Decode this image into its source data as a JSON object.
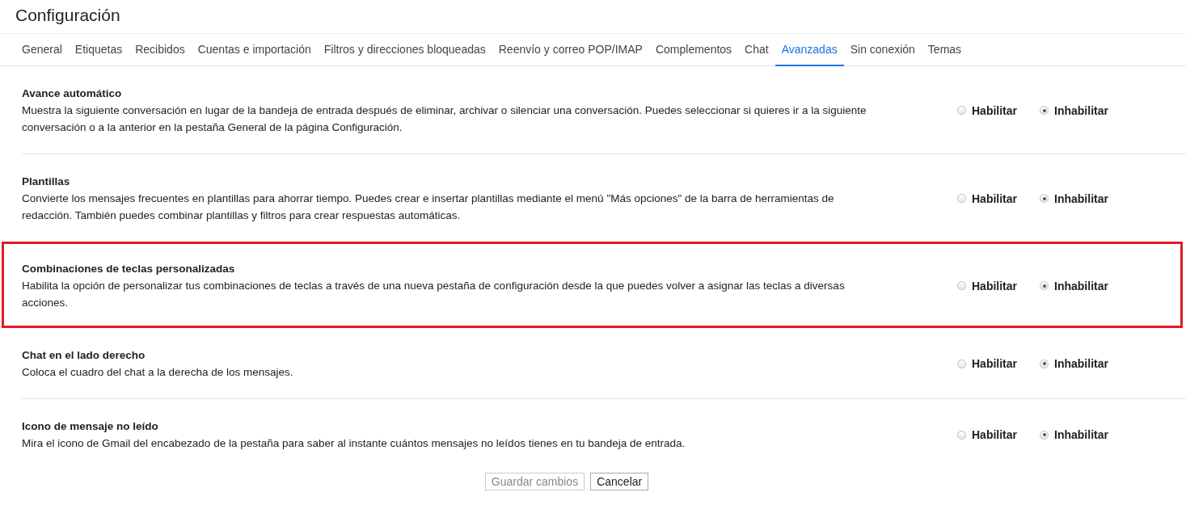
{
  "page": {
    "title": "Configuración"
  },
  "tabs": [
    {
      "label": "General",
      "selected": false
    },
    {
      "label": "Etiquetas",
      "selected": false
    },
    {
      "label": "Recibidos",
      "selected": false
    },
    {
      "label": "Cuentas e importación",
      "selected": false
    },
    {
      "label": "Filtros y direcciones bloqueadas",
      "selected": false
    },
    {
      "label": "Reenvío y correo POP/IMAP",
      "selected": false
    },
    {
      "label": "Complementos",
      "selected": false
    },
    {
      "label": "Chat",
      "selected": false
    },
    {
      "label": "Avanzadas",
      "selected": true
    },
    {
      "label": "Sin conexión",
      "selected": false
    },
    {
      "label": "Temas",
      "selected": false
    }
  ],
  "settings": [
    {
      "title": "Avance automático",
      "description": "Muestra la siguiente conversación en lugar de la bandeja de entrada después de eliminar, archivar o silenciar una conversación. Puedes seleccionar si quieres ir a la siguiente conversación o a la anterior en la pestaña General de la página Configuración.",
      "highlighted": false,
      "options": [
        {
          "label": "Habilitar",
          "selected": false
        },
        {
          "label": "Inhabilitar",
          "selected": true
        }
      ]
    },
    {
      "title": "Plantillas",
      "description": "Convierte los mensajes frecuentes en plantillas para ahorrar tiempo. Puedes crear e insertar plantillas mediante el menú \"Más opciones\" de la barra de herramientas de redacción. También puedes combinar plantillas y filtros para crear respuestas automáticas.",
      "highlighted": false,
      "options": [
        {
          "label": "Habilitar",
          "selected": false
        },
        {
          "label": "Inhabilitar",
          "selected": true
        }
      ]
    },
    {
      "title": "Combinaciones de teclas personalizadas",
      "description": "Habilita la opción de personalizar tus combinaciones de teclas a través de una nueva pestaña de configuración desde la que puedes volver a asignar las teclas a diversas acciones.",
      "highlighted": true,
      "options": [
        {
          "label": "Habilitar",
          "selected": false
        },
        {
          "label": "Inhabilitar",
          "selected": true
        }
      ]
    },
    {
      "title": "Chat en el lado derecho",
      "description": "Coloca el cuadro del chat a la derecha de los mensajes.",
      "highlighted": false,
      "options": [
        {
          "label": "Habilitar",
          "selected": false
        },
        {
          "label": "Inhabilitar",
          "selected": true
        }
      ]
    },
    {
      "title": "Icono de mensaje no leído",
      "description": "Mira el icono de Gmail del encabezado de la pestaña para saber al instante cuántos mensajes no leídos tienes en tu bandeja de entrada.",
      "highlighted": false,
      "options": [
        {
          "label": "Habilitar",
          "selected": false
        },
        {
          "label": "Inhabilitar",
          "selected": true
        }
      ]
    }
  ],
  "buttons": [
    {
      "label": "Guardar cambios",
      "disabled": true
    },
    {
      "label": "Cancelar",
      "disabled": false
    }
  ]
}
